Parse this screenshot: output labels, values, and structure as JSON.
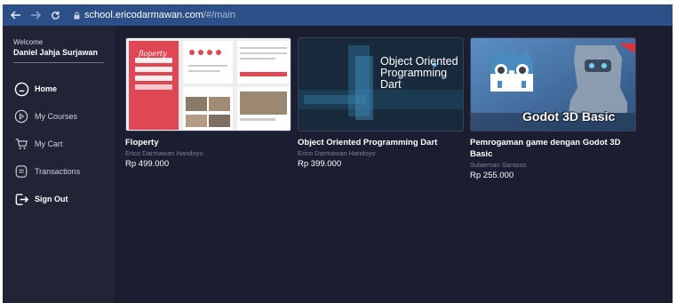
{
  "browser": {
    "url_host": "school.ericodarmawan.com",
    "url_path": "/#/main",
    "back_icon": "arrow-left-icon",
    "forward_icon": "arrow-right-icon",
    "reload_icon": "reload-icon",
    "lock_icon": "lock-icon"
  },
  "sidebar": {
    "welcome": "Welcome",
    "username": "Daniel Jahja Surjawan",
    "items": [
      {
        "label": "Home",
        "icon": "home-icon"
      },
      {
        "label": "My Courses",
        "icon": "play-circle-icon"
      },
      {
        "label": "My Cart",
        "icon": "cart-icon"
      },
      {
        "label": "Transactions",
        "icon": "document-icon"
      },
      {
        "label": "Sign Out",
        "icon": "sign-out-icon"
      }
    ]
  },
  "courses": [
    {
      "title": "Floperty",
      "author": "Erico Darmawan Handoyo",
      "price": "Rp 499.000",
      "thumb_text": "floperty"
    },
    {
      "title": "Object Oriented Programming Dart",
      "author": "Erico Darmawan Handoyo",
      "price": "Rp 399.000",
      "thumb_text": "Object Oriented Programming Dart"
    },
    {
      "title": "Pemrogaman game dengan Godot 3D Basic",
      "author": "Sulaeman Santoso",
      "price": "Rp 255.000",
      "thumb_text": "Godot 3D Basic"
    }
  ],
  "colors": {
    "browser_bar": "#2c4f88",
    "sidebar": "#222436",
    "content": "#1b1d30",
    "floperty_red": "#e04755",
    "dart_bg": "#16283a",
    "godot_blue": "#4a7fb8"
  }
}
